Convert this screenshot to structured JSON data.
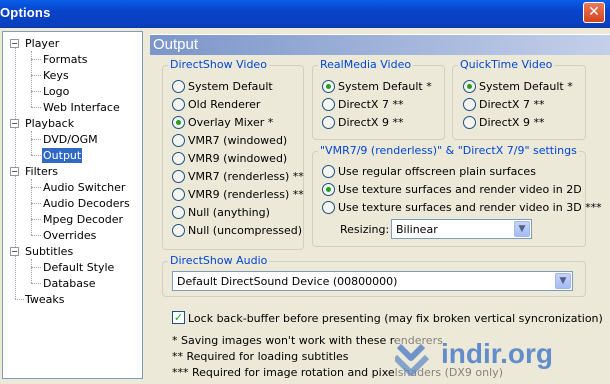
{
  "window": {
    "title": "Options"
  },
  "tree": {
    "player": "Player",
    "formats": "Formats",
    "keys": "Keys",
    "logo": "Logo",
    "web_interface": "Web Interface",
    "playback": "Playback",
    "dvd_ogm": "DVD/OGM",
    "output": "Output",
    "filters": "Filters",
    "audio_switcher": "Audio Switcher",
    "audio_decoders": "Audio Decoders",
    "mpeg_decoder": "Mpeg Decoder",
    "overrides": "Overrides",
    "subtitles": "Subtitles",
    "default_style": "Default Style",
    "database": "Database",
    "tweaks": "Tweaks"
  },
  "panel": {
    "title": "Output"
  },
  "directshow_video": {
    "label": "DirectShow Video",
    "options": [
      "System Default",
      "Old Renderer",
      "Overlay Mixer *",
      "VMR7 (windowed)",
      "VMR9 (windowed)",
      "VMR7 (renderless) **",
      "VMR9 (renderless) **",
      "Null (anything)",
      "Null (uncompressed)"
    ],
    "selected": "Overlay Mixer *"
  },
  "realmedia_video": {
    "label": "RealMedia Video",
    "options": [
      "System Default *",
      "DirectX 7 **",
      "DirectX 9 **"
    ],
    "selected": "System Default *"
  },
  "quicktime_video": {
    "label": "QuickTime Video",
    "options": [
      "System Default *",
      "DirectX 7 **",
      "DirectX 9 **"
    ],
    "selected": "System Default *"
  },
  "vmr_settings": {
    "label": "\"VMR7/9 (renderless)\" & \"DirectX 7/9\" settings",
    "options": [
      "Use regular offscreen plain surfaces",
      "Use texture surfaces and render video in 2D",
      "Use texture surfaces and render video in 3D ***"
    ],
    "selected": "Use texture surfaces and render video in 2D",
    "resizing_label": "Resizing:",
    "resizing_value": "Bilinear"
  },
  "directshow_audio": {
    "label": "DirectShow Audio",
    "device": "Default DirectSound Device (00800000)"
  },
  "lock_backbuffer": {
    "label": "Lock back-buffer before presenting (may fix broken vertical syncronization)",
    "checked": true
  },
  "notes": {
    "n1": "* Saving images won't work with these renderers",
    "n2": "** Required for loading subtitles",
    "n3": "*** Required for image rotation and pixelshaders (DX9 only)"
  },
  "watermark": {
    "text": "indir.org"
  },
  "colors": {
    "titlebar": "#0a5ee8",
    "selection": "#316ac5",
    "group_label": "#0046d5",
    "radio_dot": "#21a121"
  }
}
